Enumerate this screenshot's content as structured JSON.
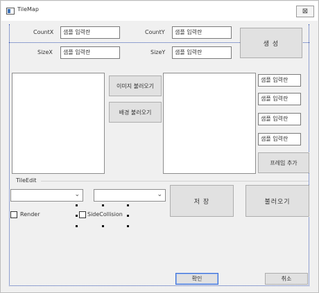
{
  "window": {
    "title": "TileMap",
    "close_label": "⊠"
  },
  "labels": {
    "count_x": "CountX",
    "count_y": "CountY",
    "size_x": "SizeX",
    "size_y": "SizeY",
    "tile_edit": "TileEdit",
    "render": "Render",
    "side_collision": "SideCollision"
  },
  "inputs": {
    "count_x": "샘플 입력란",
    "count_y": "샘플 입력란",
    "size_x": "샘플 입력란",
    "size_y": "샘플 입력란",
    "right_1": "샘플 입력란",
    "right_2": "샘플 입력란",
    "right_3": "샘플 입력란",
    "right_4": "샘플 입력란"
  },
  "buttons": {
    "create": "생 성",
    "load_image": "이미지 불러오기",
    "load_background": "배경 불러오기",
    "add_frame": "프레임 추가",
    "save": "저 장",
    "load": "불러오기",
    "ok": "확인",
    "cancel": "취소"
  },
  "combos": {
    "left_value": "",
    "right_value": ""
  },
  "checkboxes": {
    "render": false,
    "side_collision": false
  }
}
